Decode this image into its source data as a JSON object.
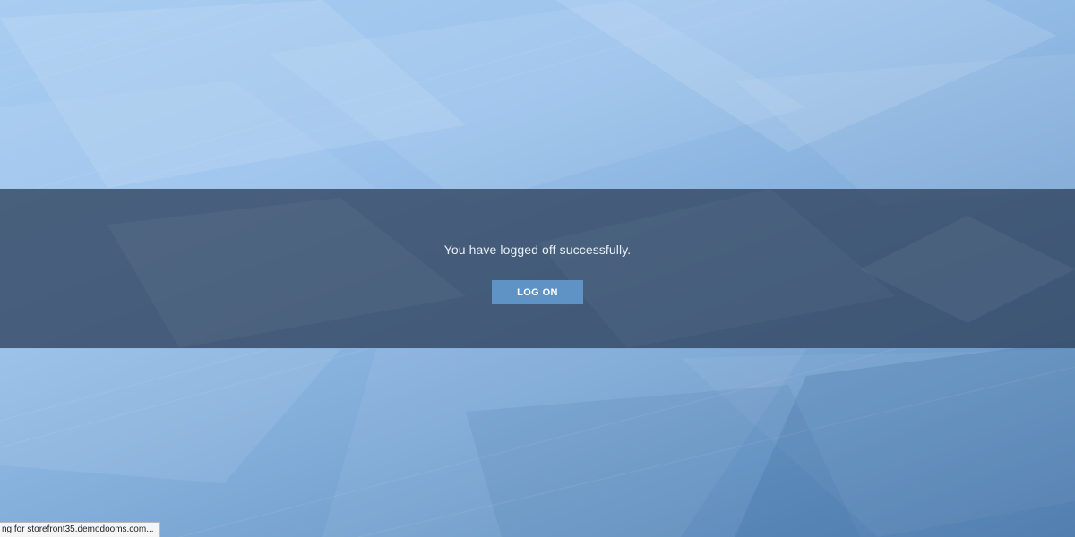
{
  "page": {
    "message": "You have logged off successfully.",
    "logon_button_label": "LOG ON"
  },
  "statusbar": {
    "text": "ng for storefront35.demodooms.com..."
  },
  "colors": {
    "band": "#30425c",
    "button": "#5f93c5",
    "background": "#8fb6de"
  }
}
